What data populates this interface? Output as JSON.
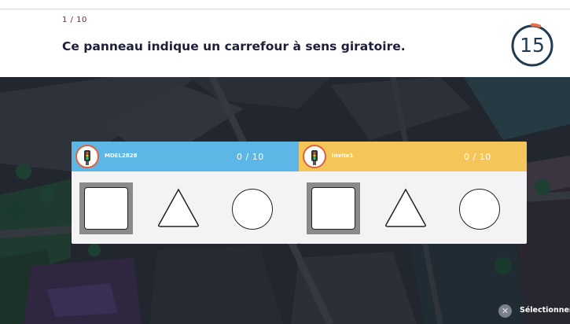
{
  "quiz": {
    "progress": "1 / 10",
    "question": "Ce panneau indique un carrefour à sens giratoire.",
    "timer": "15",
    "timer_remaining_fraction": 0.93
  },
  "players": [
    {
      "name": "MDEL2828",
      "score": "0 / 10",
      "header_color": "#5db7e6",
      "avatar_icon": "traffic-light-character-icon"
    },
    {
      "name": "Invite1",
      "score": "0 / 10",
      "header_color": "#f4c65a",
      "avatar_icon": "traffic-light-character-icon"
    }
  ],
  "shapes": [
    "square",
    "triangle",
    "circle"
  ],
  "selected_shape": "square",
  "footer": {
    "button_icon": "x-icon",
    "button_label": "Sélectionner"
  },
  "colors": {
    "accent_dark": "#1e1e3a",
    "progress_color": "#7a2340",
    "timer_ring": "#1f3a52",
    "timer_progress": "#e8704a"
  }
}
